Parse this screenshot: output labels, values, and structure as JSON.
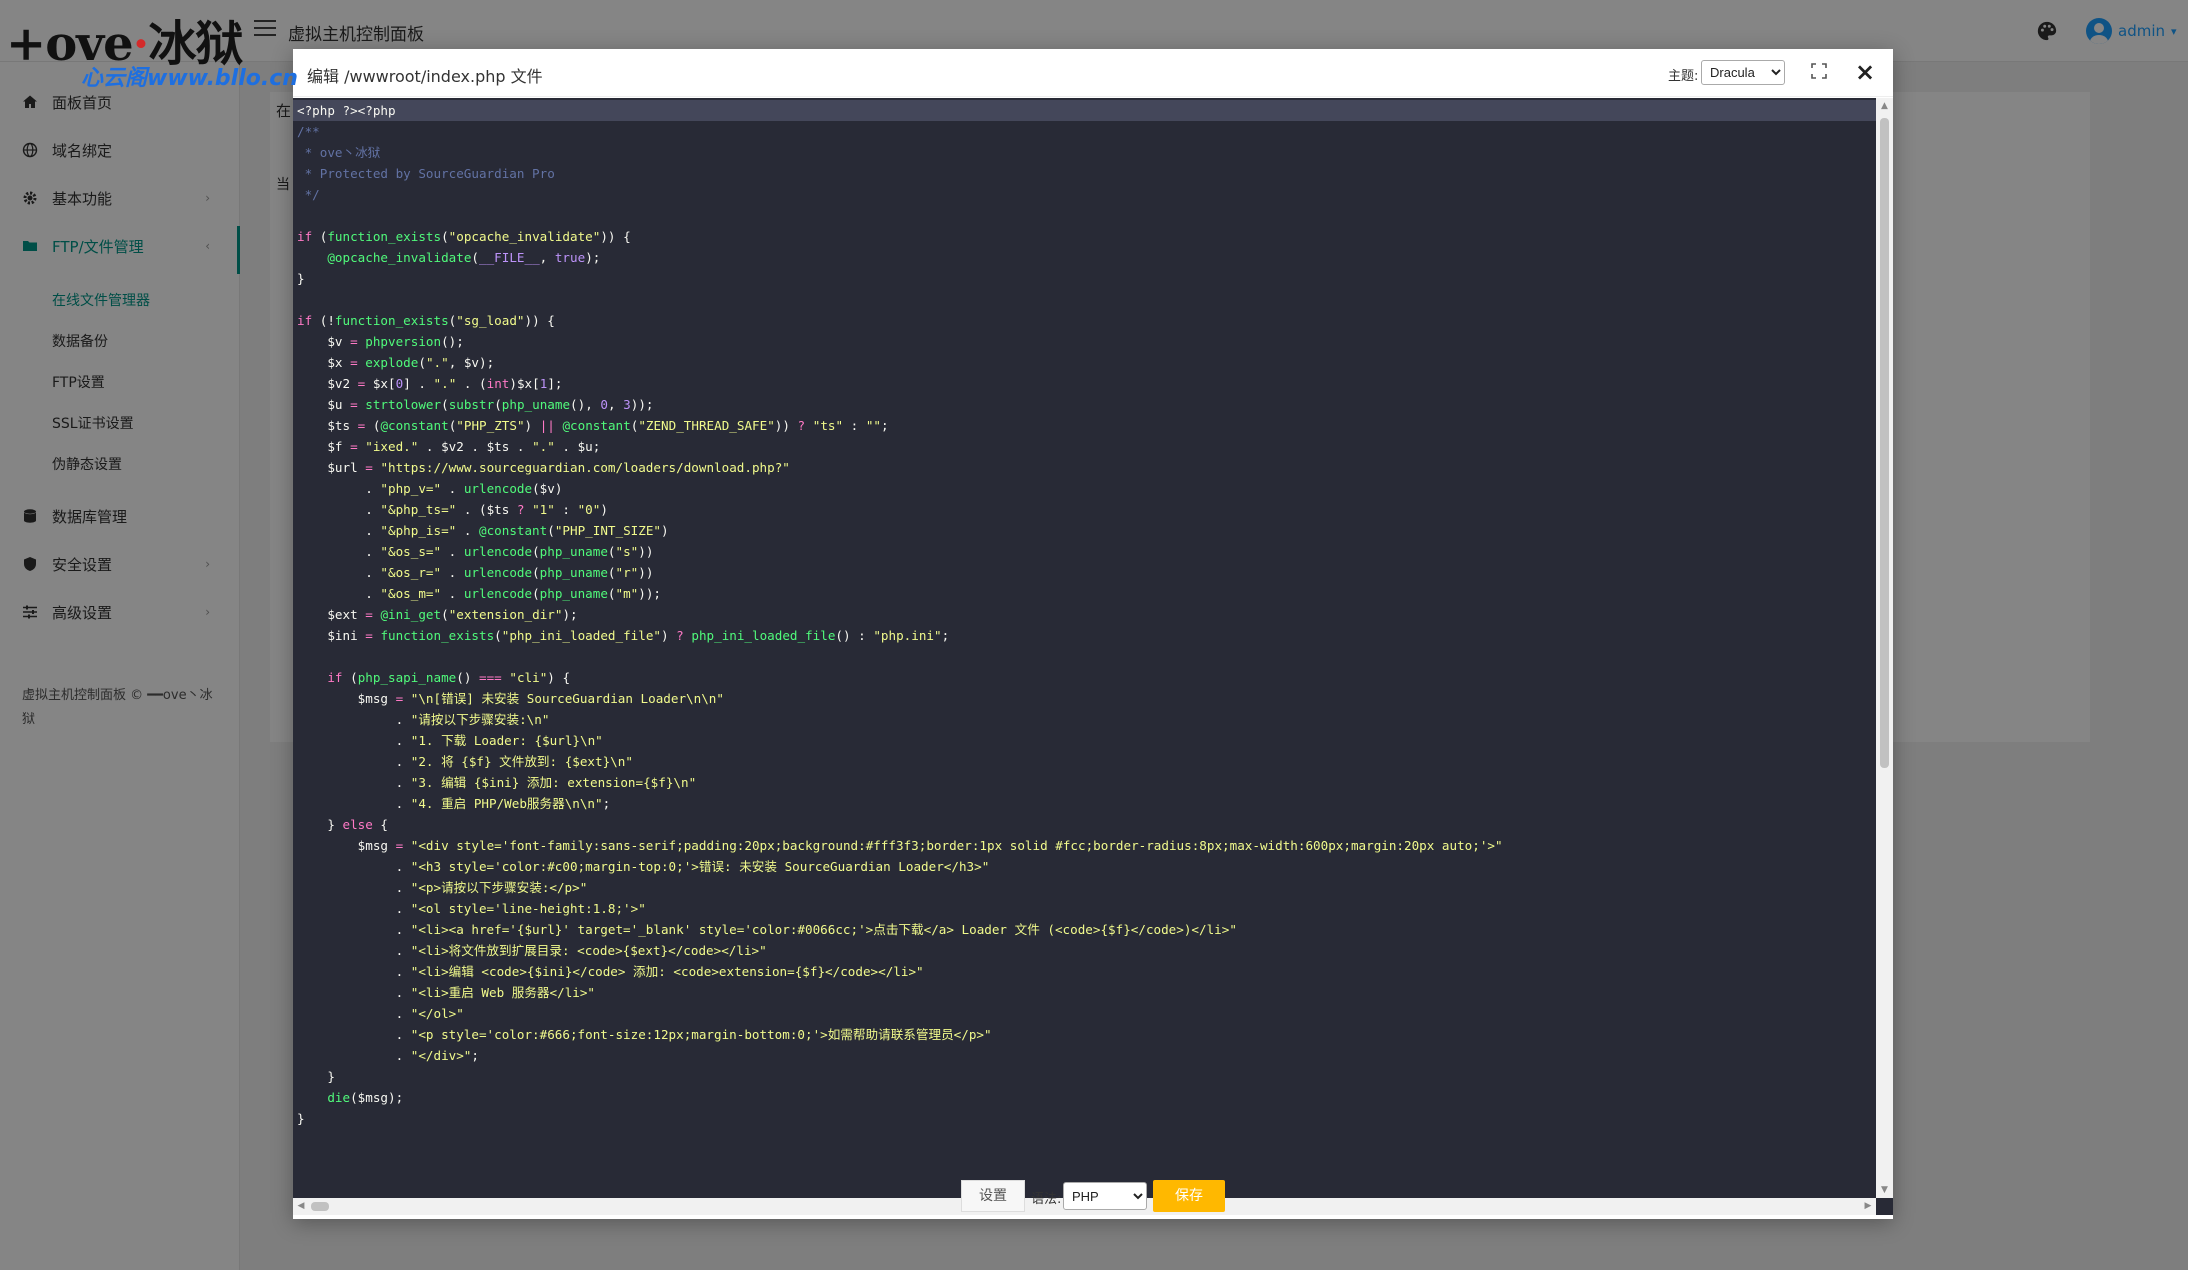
{
  "logo": {
    "line1_a": "+ove",
    "line1_dot": "·",
    "line1_b": "冰狱",
    "line2": "心云阁www.bllo.cn"
  },
  "header": {
    "title": "虚拟主机控制面板",
    "user": "admin",
    "user_caret": "▾"
  },
  "sidebar": {
    "items": [
      {
        "label": "面板首页",
        "icon": "home-icon"
      },
      {
        "label": "域名绑定",
        "icon": "globe-icon"
      },
      {
        "label": "基本功能",
        "icon": "gear-icon",
        "arrow": "›"
      },
      {
        "label": "FTP/文件管理",
        "icon": "folder-icon",
        "arrow": "‹"
      },
      {
        "label": "数据库管理",
        "icon": "database-icon"
      },
      {
        "label": "安全设置",
        "icon": "shield-icon",
        "arrow": "›"
      },
      {
        "label": "高级设置",
        "icon": "sliders-icon",
        "arrow": "›"
      }
    ],
    "subitems": [
      {
        "label": "在线文件管理器"
      },
      {
        "label": "数据备份"
      },
      {
        "label": "FTP设置"
      },
      {
        "label": "SSL证书设置"
      },
      {
        "label": "伪静态设置"
      }
    ],
    "footer": "虚拟主机控制面板 © ━━ove丶冰狱"
  },
  "content": {
    "peek1": "在",
    "peek2": "当"
  },
  "modal": {
    "title": "编辑 /wwwroot/index.php 文件",
    "theme_label": "主题:",
    "theme_value": "Dracula",
    "close": "×",
    "syntax_label": "语法:",
    "syntax_value": "PHP",
    "settings_label": "设置",
    "save_label": "保存"
  },
  "code_lines": [
    [
      [
        "v",
        "<?php ?><?php"
      ]
    ],
    [
      [
        "c",
        "/**"
      ]
    ],
    [
      [
        "c",
        " * ove丶冰狱"
      ]
    ],
    [
      [
        "c",
        " * Protected by SourceGuardian Pro"
      ]
    ],
    [
      [
        "c",
        " */"
      ]
    ],
    [
      [
        "v",
        ""
      ]
    ],
    [
      [
        "k",
        "if"
      ],
      [
        "v",
        " ("
      ],
      [
        "f",
        "function_exists"
      ],
      [
        "v",
        "("
      ],
      [
        "s",
        "\"opcache_invalidate\""
      ],
      [
        "v",
        ")) {"
      ]
    ],
    [
      [
        "v",
        "    "
      ],
      [
        "f",
        "@opcache_invalidate"
      ],
      [
        "v",
        "("
      ],
      [
        "n",
        "__FILE__"
      ],
      [
        "v",
        ", "
      ],
      [
        "n",
        "true"
      ],
      [
        "v",
        ");"
      ]
    ],
    [
      [
        "v",
        "}"
      ]
    ],
    [
      [
        "v",
        ""
      ]
    ],
    [
      [
        "k",
        "if"
      ],
      [
        "v",
        " (!"
      ],
      [
        "f",
        "function_exists"
      ],
      [
        "v",
        "("
      ],
      [
        "s",
        "\"sg_load\""
      ],
      [
        "v",
        ")) {"
      ]
    ],
    [
      [
        "v",
        "    $v "
      ],
      [
        "o",
        "="
      ],
      [
        "v",
        " "
      ],
      [
        "f",
        "phpversion"
      ],
      [
        "v",
        "();"
      ]
    ],
    [
      [
        "v",
        "    $x "
      ],
      [
        "o",
        "="
      ],
      [
        "v",
        " "
      ],
      [
        "f",
        "explode"
      ],
      [
        "v",
        "("
      ],
      [
        "s",
        "\".\""
      ],
      [
        "v",
        ", $v);"
      ]
    ],
    [
      [
        "v",
        "    $v2 "
      ],
      [
        "o",
        "="
      ],
      [
        "v",
        " $x["
      ],
      [
        "n",
        "0"
      ],
      [
        "v",
        "] . "
      ],
      [
        "s",
        "\".\""
      ],
      [
        "v",
        " . ("
      ],
      [
        "k",
        "int"
      ],
      [
        "v",
        ")$x["
      ],
      [
        "n",
        "1"
      ],
      [
        "v",
        "];"
      ]
    ],
    [
      [
        "v",
        "    $u "
      ],
      [
        "o",
        "="
      ],
      [
        "v",
        " "
      ],
      [
        "f",
        "strtolower"
      ],
      [
        "v",
        "("
      ],
      [
        "f",
        "substr"
      ],
      [
        "v",
        "("
      ],
      [
        "f",
        "php_uname"
      ],
      [
        "v",
        "(), "
      ],
      [
        "n",
        "0"
      ],
      [
        "v",
        ", "
      ],
      [
        "n",
        "3"
      ],
      [
        "v",
        "));"
      ]
    ],
    [
      [
        "v",
        "    $ts "
      ],
      [
        "o",
        "="
      ],
      [
        "v",
        " ("
      ],
      [
        "f",
        "@constant"
      ],
      [
        "v",
        "("
      ],
      [
        "s",
        "\"PHP_ZTS\""
      ],
      [
        "v",
        ") "
      ],
      [
        "o",
        "||"
      ],
      [
        "v",
        " "
      ],
      [
        "f",
        "@constant"
      ],
      [
        "v",
        "("
      ],
      [
        "s",
        "\"ZEND_THREAD_SAFE\""
      ],
      [
        "v",
        ")) "
      ],
      [
        "o",
        "?"
      ],
      [
        "v",
        " "
      ],
      [
        "s",
        "\"ts\""
      ],
      [
        "v",
        " : "
      ],
      [
        "s",
        "\"\""
      ],
      [
        "v",
        ";"
      ]
    ],
    [
      [
        "v",
        "    $f "
      ],
      [
        "o",
        "="
      ],
      [
        "v",
        " "
      ],
      [
        "s",
        "\"ixed.\""
      ],
      [
        "v",
        " . $v2 . $ts . "
      ],
      [
        "s",
        "\".\""
      ],
      [
        "v",
        " . $u;"
      ]
    ],
    [
      [
        "v",
        "    $url "
      ],
      [
        "o",
        "="
      ],
      [
        "v",
        " "
      ],
      [
        "s",
        "\"https://www.sourceguardian.com/loaders/download.php?\""
      ]
    ],
    [
      [
        "v",
        "         . "
      ],
      [
        "s",
        "\"php_v=\""
      ],
      [
        "v",
        " . "
      ],
      [
        "f",
        "urlencode"
      ],
      [
        "v",
        "($v)"
      ]
    ],
    [
      [
        "v",
        "         . "
      ],
      [
        "s",
        "\"&php_ts=\""
      ],
      [
        "v",
        " . ($ts "
      ],
      [
        "o",
        "?"
      ],
      [
        "v",
        " "
      ],
      [
        "s",
        "\"1\""
      ],
      [
        "v",
        " : "
      ],
      [
        "s",
        "\"0\""
      ],
      [
        "v",
        ")"
      ]
    ],
    [
      [
        "v",
        "         . "
      ],
      [
        "s",
        "\"&php_is=\""
      ],
      [
        "v",
        " . "
      ],
      [
        "f",
        "@constant"
      ],
      [
        "v",
        "("
      ],
      [
        "s",
        "\"PHP_INT_SIZE\""
      ],
      [
        "v",
        ")"
      ]
    ],
    [
      [
        "v",
        "         . "
      ],
      [
        "s",
        "\"&os_s=\""
      ],
      [
        "v",
        " . "
      ],
      [
        "f",
        "urlencode"
      ],
      [
        "v",
        "("
      ],
      [
        "f",
        "php_uname"
      ],
      [
        "v",
        "("
      ],
      [
        "s",
        "\"s\""
      ],
      [
        "v",
        "))"
      ]
    ],
    [
      [
        "v",
        "         . "
      ],
      [
        "s",
        "\"&os_r=\""
      ],
      [
        "v",
        " . "
      ],
      [
        "f",
        "urlencode"
      ],
      [
        "v",
        "("
      ],
      [
        "f",
        "php_uname"
      ],
      [
        "v",
        "("
      ],
      [
        "s",
        "\"r\""
      ],
      [
        "v",
        "))"
      ]
    ],
    [
      [
        "v",
        "         . "
      ],
      [
        "s",
        "\"&os_m=\""
      ],
      [
        "v",
        " . "
      ],
      [
        "f",
        "urlencode"
      ],
      [
        "v",
        "("
      ],
      [
        "f",
        "php_uname"
      ],
      [
        "v",
        "("
      ],
      [
        "s",
        "\"m\""
      ],
      [
        "v",
        "));"
      ]
    ],
    [
      [
        "v",
        "    $ext "
      ],
      [
        "o",
        "="
      ],
      [
        "v",
        " "
      ],
      [
        "f",
        "@ini_get"
      ],
      [
        "v",
        "("
      ],
      [
        "s",
        "\"extension_dir\""
      ],
      [
        "v",
        ");"
      ]
    ],
    [
      [
        "v",
        "    $ini "
      ],
      [
        "o",
        "="
      ],
      [
        "v",
        " "
      ],
      [
        "f",
        "function_exists"
      ],
      [
        "v",
        "("
      ],
      [
        "s",
        "\"php_ini_loaded_file\""
      ],
      [
        "v",
        ") "
      ],
      [
        "o",
        "?"
      ],
      [
        "v",
        " "
      ],
      [
        "f",
        "php_ini_loaded_file"
      ],
      [
        "v",
        "() : "
      ],
      [
        "s",
        "\"php.ini\""
      ],
      [
        "v",
        ";"
      ]
    ],
    [
      [
        "v",
        ""
      ]
    ],
    [
      [
        "v",
        "    "
      ],
      [
        "k",
        "if"
      ],
      [
        "v",
        " ("
      ],
      [
        "f",
        "php_sapi_name"
      ],
      [
        "v",
        "() "
      ],
      [
        "o",
        "==="
      ],
      [
        "v",
        " "
      ],
      [
        "s",
        "\"cli\""
      ],
      [
        "v",
        ") {"
      ]
    ],
    [
      [
        "v",
        "        $msg "
      ],
      [
        "o",
        "="
      ],
      [
        "v",
        " "
      ],
      [
        "s",
        "\"\\n[错误] 未安装 SourceGuardian Loader\\n\\n\""
      ]
    ],
    [
      [
        "v",
        "             . "
      ],
      [
        "s",
        "\"请按以下步骤安装:\\n\""
      ]
    ],
    [
      [
        "v",
        "             . "
      ],
      [
        "s",
        "\"1. 下载 Loader: {$url}\\n\""
      ]
    ],
    [
      [
        "v",
        "             . "
      ],
      [
        "s",
        "\"2. 将 {$f} 文件放到: {$ext}\\n\""
      ]
    ],
    [
      [
        "v",
        "             . "
      ],
      [
        "s",
        "\"3. 编辑 {$ini} 添加: extension={$f}\\n\""
      ]
    ],
    [
      [
        "v",
        "             . "
      ],
      [
        "s",
        "\"4. 重启 PHP/Web服务器\\n\\n\""
      ],
      [
        "v",
        ";"
      ]
    ],
    [
      [
        "v",
        "    } "
      ],
      [
        "k",
        "else"
      ],
      [
        "v",
        " {"
      ]
    ],
    [
      [
        "v",
        "        $msg "
      ],
      [
        "o",
        "="
      ],
      [
        "v",
        " "
      ],
      [
        "s",
        "\"<div style='font-family:sans-serif;padding:20px;background:#fff3f3;border:1px solid #fcc;border-radius:8px;max-width:600px;margin:20px auto;'>\""
      ]
    ],
    [
      [
        "v",
        "             . "
      ],
      [
        "s",
        "\"<h3 style='color:#c00;margin-top:0;'>错误: 未安装 SourceGuardian Loader</h3>\""
      ]
    ],
    [
      [
        "v",
        "             . "
      ],
      [
        "s",
        "\"<p>请按以下步骤安装:</p>\""
      ]
    ],
    [
      [
        "v",
        "             . "
      ],
      [
        "s",
        "\"<ol style='line-height:1.8;'>\""
      ]
    ],
    [
      [
        "v",
        "             . "
      ],
      [
        "s",
        "\"<li><a href='{$url}' target='_blank' style='color:#0066cc;'>点击下载</a> Loader 文件 (<code>{$f}</code>)</li>\""
      ]
    ],
    [
      [
        "v",
        "             . "
      ],
      [
        "s",
        "\"<li>将文件放到扩展目录: <code>{$ext}</code></li>\""
      ]
    ],
    [
      [
        "v",
        "             . "
      ],
      [
        "s",
        "\"<li>编辑 <code>{$ini}</code> 添加: <code>extension={$f}</code></li>\""
      ]
    ],
    [
      [
        "v",
        "             . "
      ],
      [
        "s",
        "\"<li>重启 Web 服务器</li>\""
      ]
    ],
    [
      [
        "v",
        "             . "
      ],
      [
        "s",
        "\"</ol>\""
      ]
    ],
    [
      [
        "v",
        "             . "
      ],
      [
        "s",
        "\"<p style='color:#666;font-size:12px;margin-bottom:0;'>如需帮助请联系管理员</p>\""
      ]
    ],
    [
      [
        "v",
        "             . "
      ],
      [
        "s",
        "\"</div>\""
      ],
      [
        "v",
        ";"
      ]
    ],
    [
      [
        "v",
        "    }"
      ]
    ],
    [
      [
        "v",
        "    "
      ],
      [
        "f",
        "die"
      ],
      [
        "v",
        "($msg);"
      ]
    ],
    [
      [
        "v",
        "}"
      ]
    ]
  ]
}
